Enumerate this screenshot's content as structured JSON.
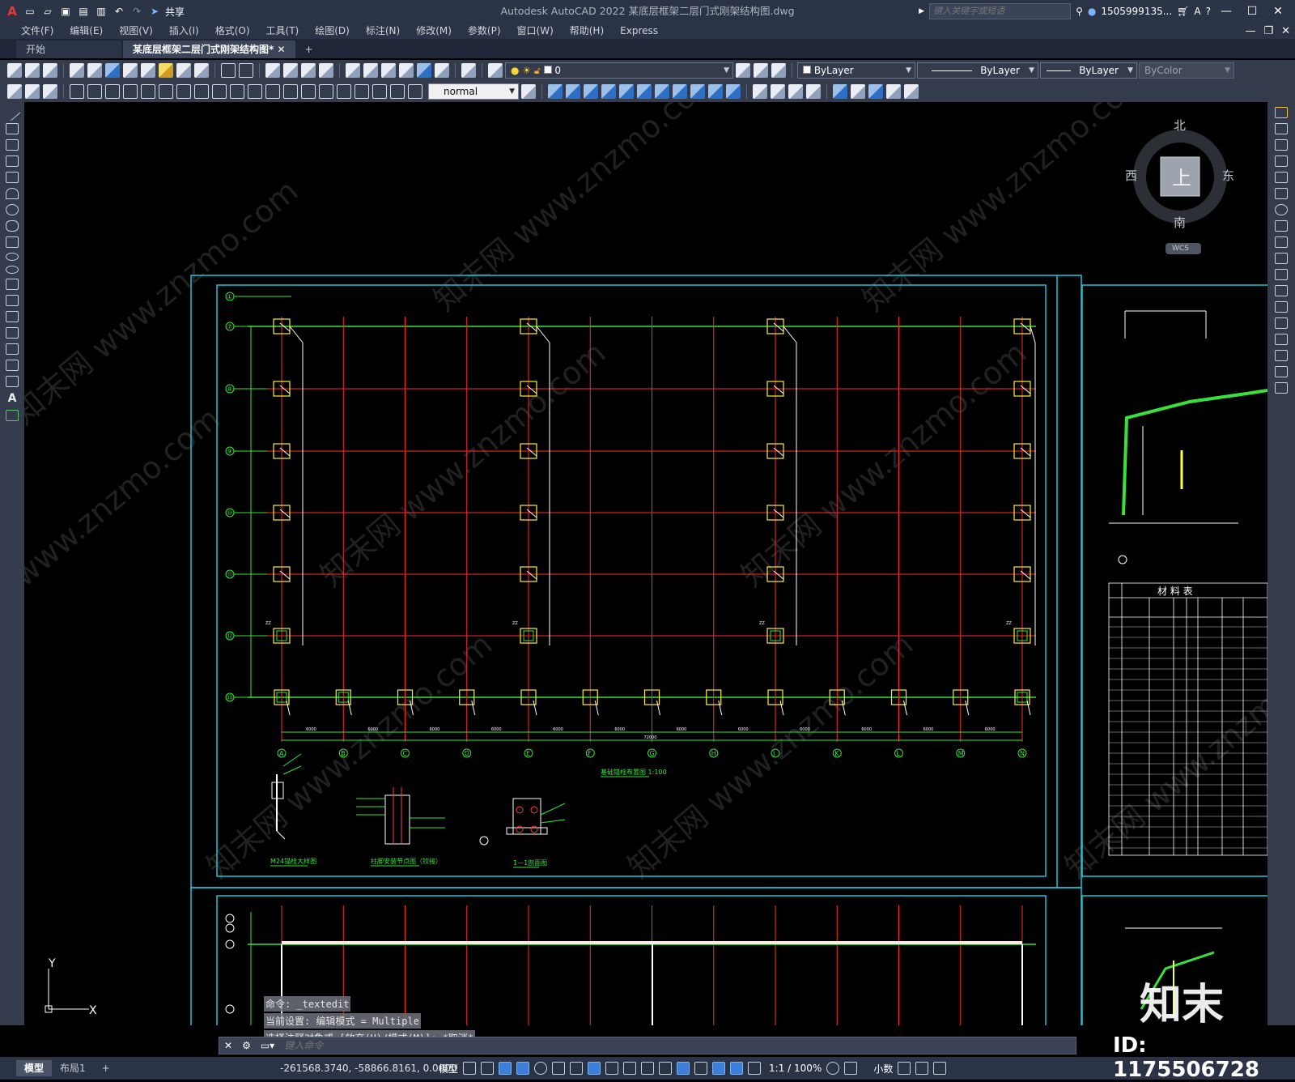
{
  "window": {
    "title": "Autodesk AutoCAD 2022    某底层框架二层门式刚架结构图.dwg",
    "search_placeholder": "键入关键字或短语",
    "user": "1505999135...",
    "share_label": "共享"
  },
  "menu": [
    "文件(F)",
    "编辑(E)",
    "视图(V)",
    "插入(I)",
    "格式(O)",
    "工具(T)",
    "绘图(D)",
    "标注(N)",
    "修改(M)",
    "参数(P)",
    "窗口(W)",
    "帮助(H)",
    "Express"
  ],
  "tabs": [
    {
      "label": "开始"
    },
    {
      "label": "某底层框架二层门式刚架结构图*  ✕"
    }
  ],
  "layer_value": "0",
  "props": {
    "color": "ByLayer",
    "linetype": "ByLayer",
    "lineweight": "ByLayer",
    "plotstyle": "ByColor"
  },
  "text_style": "normal",
  "viewcube": {
    "north": "北",
    "south": "南",
    "east": "东",
    "west": "西",
    "face": "上",
    "wcs": "WCS"
  },
  "drawing": {
    "grid_rows": [
      "①",
      "⑦",
      "⑧",
      "⑨",
      "⑩",
      "⑪",
      "⑫",
      "⑬"
    ],
    "grid_cols": [
      "A",
      "B",
      "C",
      "D",
      "E",
      "F",
      "G",
      "H",
      "J",
      "K",
      "L",
      "M",
      "N"
    ],
    "total_dim": "72000",
    "span_dim": "6000",
    "plan_title": "基础锚栓布置图 1:100",
    "detail1_title": "M24锚栓大样图",
    "detail2_title": "柱脚安装节点图（铰接）",
    "detail3_title": "1—1剖面图",
    "material_table_title": "材 料 表",
    "col_tag": "ZZ"
  },
  "command": {
    "history": [
      "命令: _textedit",
      "当前设置: 编辑模式 = Multiple",
      "选择注释对象或 [放弃(U)/模式(M)]: *取消*"
    ],
    "placeholder": "键入命令"
  },
  "layout_tabs": [
    {
      "label": "模型",
      "active": true
    },
    {
      "label": "布局1",
      "active": false
    }
  ],
  "status": {
    "coords": "-261568.3740, -58866.8161, 0.0000",
    "mode": "模型",
    "scale": "1:1 / 100%",
    "units": "小数"
  },
  "watermark": {
    "logo": "知末",
    "id": "ID: 1175506728"
  }
}
